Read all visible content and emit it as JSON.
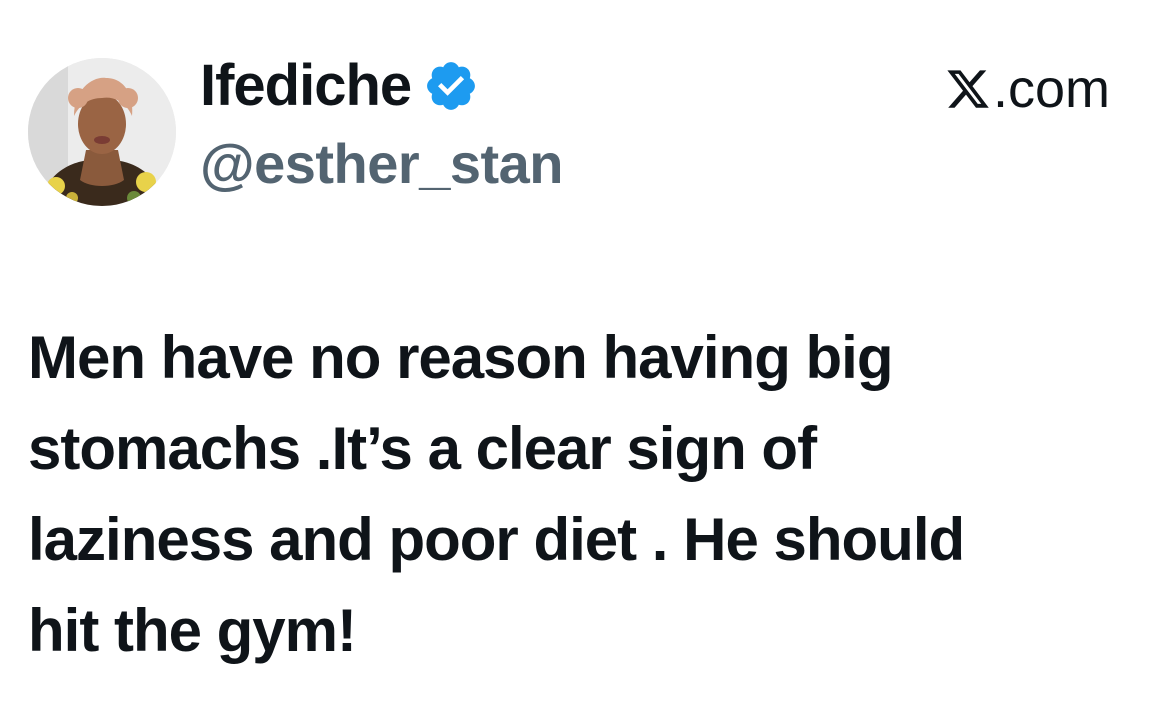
{
  "author": {
    "display_name": "Ifediche",
    "handle": "@esther_stan",
    "verified": true,
    "avatar_icon": "profile-photo"
  },
  "source": {
    "label": ".com",
    "logo_icon": "x-logo-icon"
  },
  "tweet": {
    "lines": [
      "Men have no reason having big",
      "stomachs .It’s a clear sign of",
      "laziness and poor diet . He should",
      "hit the gym!"
    ]
  },
  "colors": {
    "text_primary": "#0f1419",
    "text_secondary": "#536471",
    "verified_blue": "#1d9bf0",
    "background": "#ffffff"
  }
}
